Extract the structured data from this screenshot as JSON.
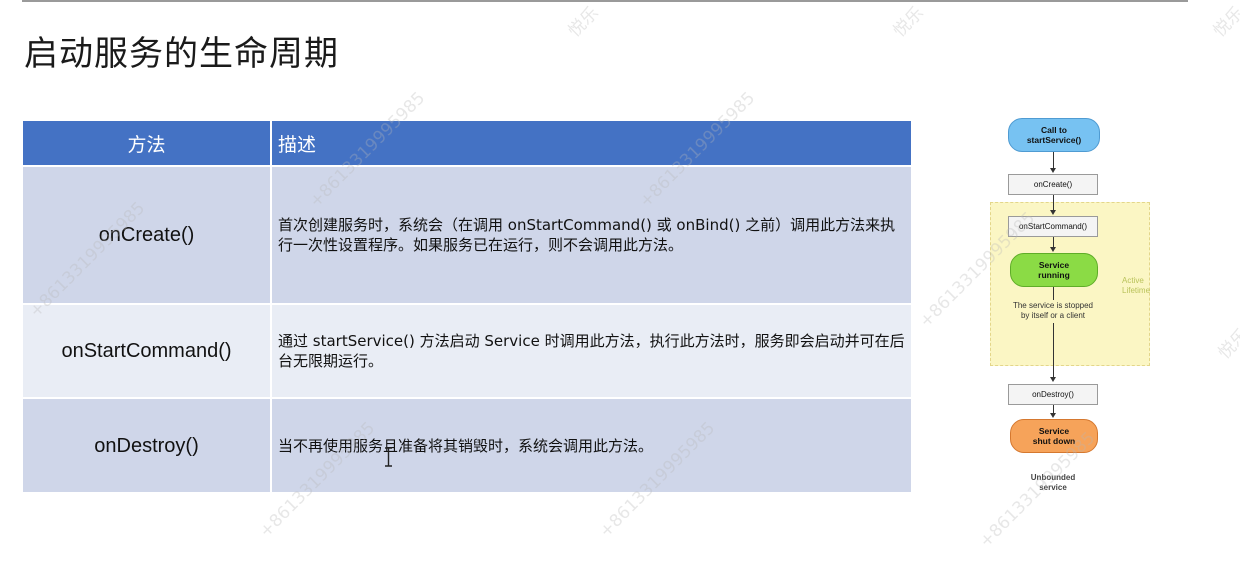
{
  "page": {
    "title": "启动服务的生命周期"
  },
  "table": {
    "headers": {
      "method": "方法",
      "description": "描述"
    },
    "rows": [
      {
        "method": "onCreate()",
        "description": "首次创建服务时，系统会（在调用 onStartCommand() 或 onBind() 之前）调用此方法来执行一次性设置程序。如果服务已在运行，则不会调用此方法。"
      },
      {
        "method": "onStartCommand()",
        "description": "通过 startService() 方法启动 Service 时调用此方法，执行此方法时，服务即会启动并可在后台无限期运行。"
      },
      {
        "method": "onDestroy()",
        "description": "当不再使用服务且准备将其销毁时，系统会调用此方法。"
      }
    ]
  },
  "diagram": {
    "call_node": [
      "Call to",
      "startService()"
    ],
    "oncreate_node": "onCreate()",
    "onstart_node": "onStartCommand()",
    "running_node": [
      "Service",
      "running"
    ],
    "stop_note": [
      "The service is stopped",
      "by itself or a client"
    ],
    "ondestroy_node": "onDestroy()",
    "shutdown_node": [
      "Service",
      "shut down"
    ],
    "unbound_note": [
      "Unbounded",
      "service"
    ],
    "active_label": [
      "Active",
      "Lifetime"
    ]
  },
  "watermarks": {
    "phone": "+8613319995985",
    "brand": "悦乐"
  }
}
